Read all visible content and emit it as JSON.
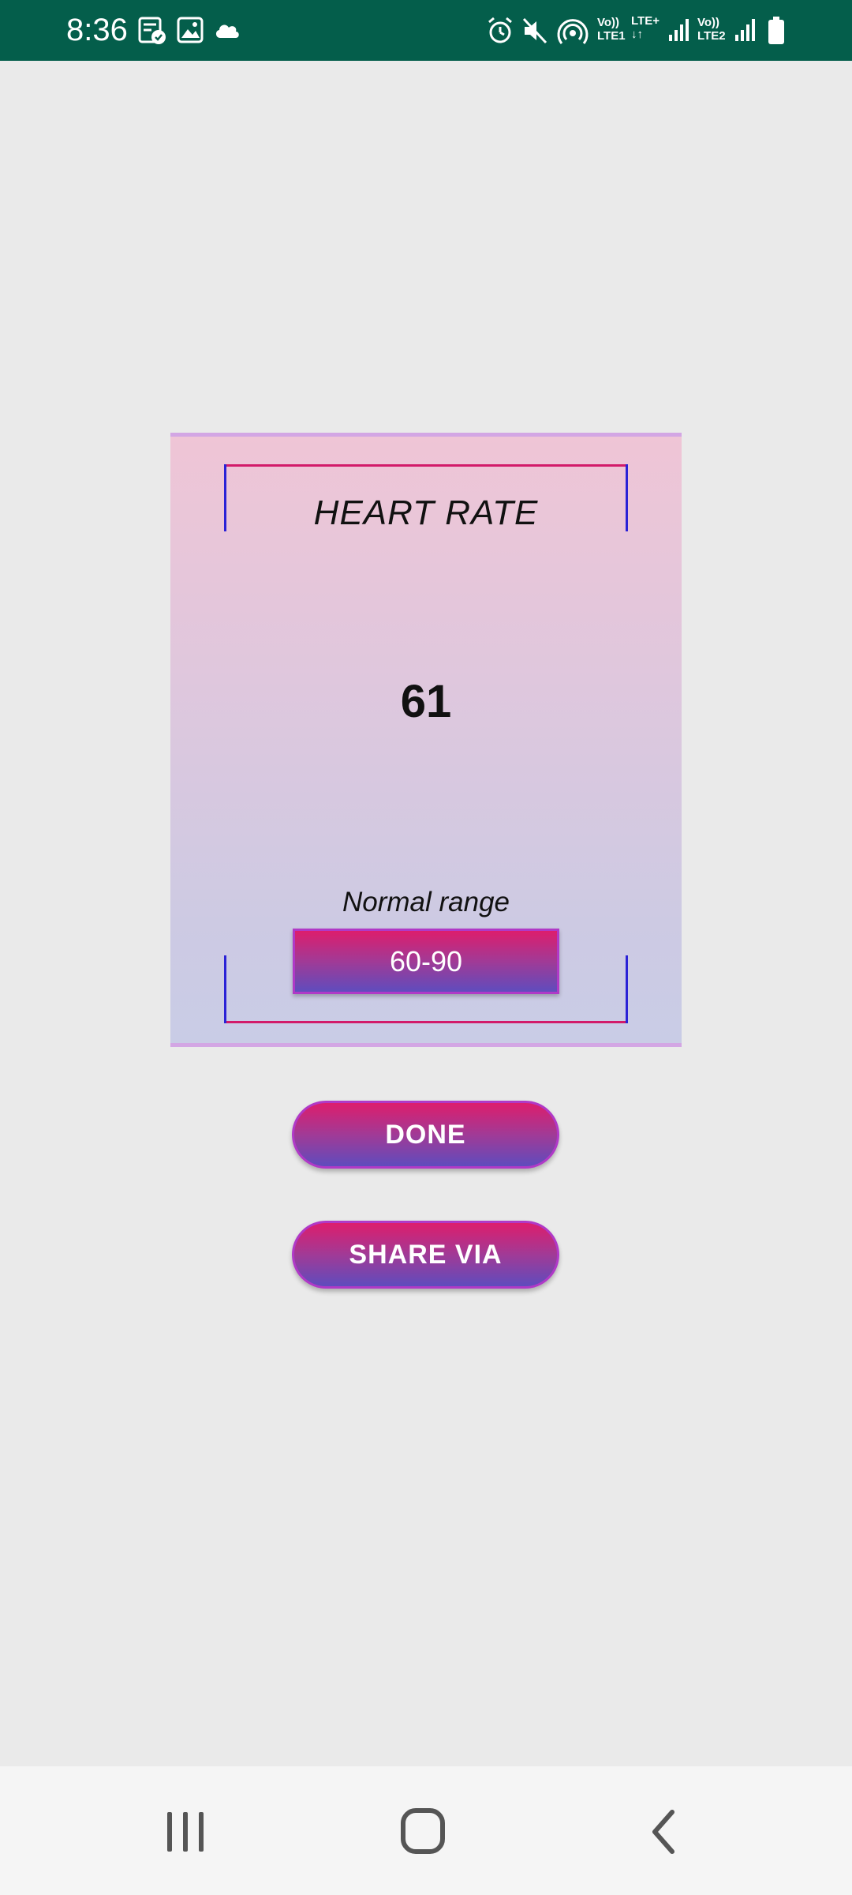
{
  "status_bar": {
    "time": "8:36",
    "sim1_label_top": "Vo))",
    "sim1_label_bottom": "LTE1",
    "lte_plus_label": "LTE+",
    "sim2_label_top": "Vo))",
    "sim2_label_bottom": "LTE2",
    "icons": [
      "task-icon",
      "gallery-icon",
      "cloud-icon",
      "alarm-icon",
      "mute-icon",
      "hotspot-icon",
      "signal-icon",
      "battery-icon"
    ]
  },
  "card": {
    "title": "HEART RATE",
    "value": "61",
    "range_label": "Normal range",
    "range_value": "60-90"
  },
  "actions": {
    "done_label": "DONE",
    "share_label": "SHARE VIA"
  },
  "nav_bar": {
    "icons": [
      "recents-icon",
      "home-icon",
      "back-icon"
    ]
  },
  "colors": {
    "status_bar": "#045e4b",
    "background": "#eaeaea",
    "gradient_top": "#dd1d6c",
    "gradient_bottom": "#5f4cbd",
    "bracket_horizontal": "#d21a6a",
    "bracket_vertical": "#2a22d6"
  }
}
